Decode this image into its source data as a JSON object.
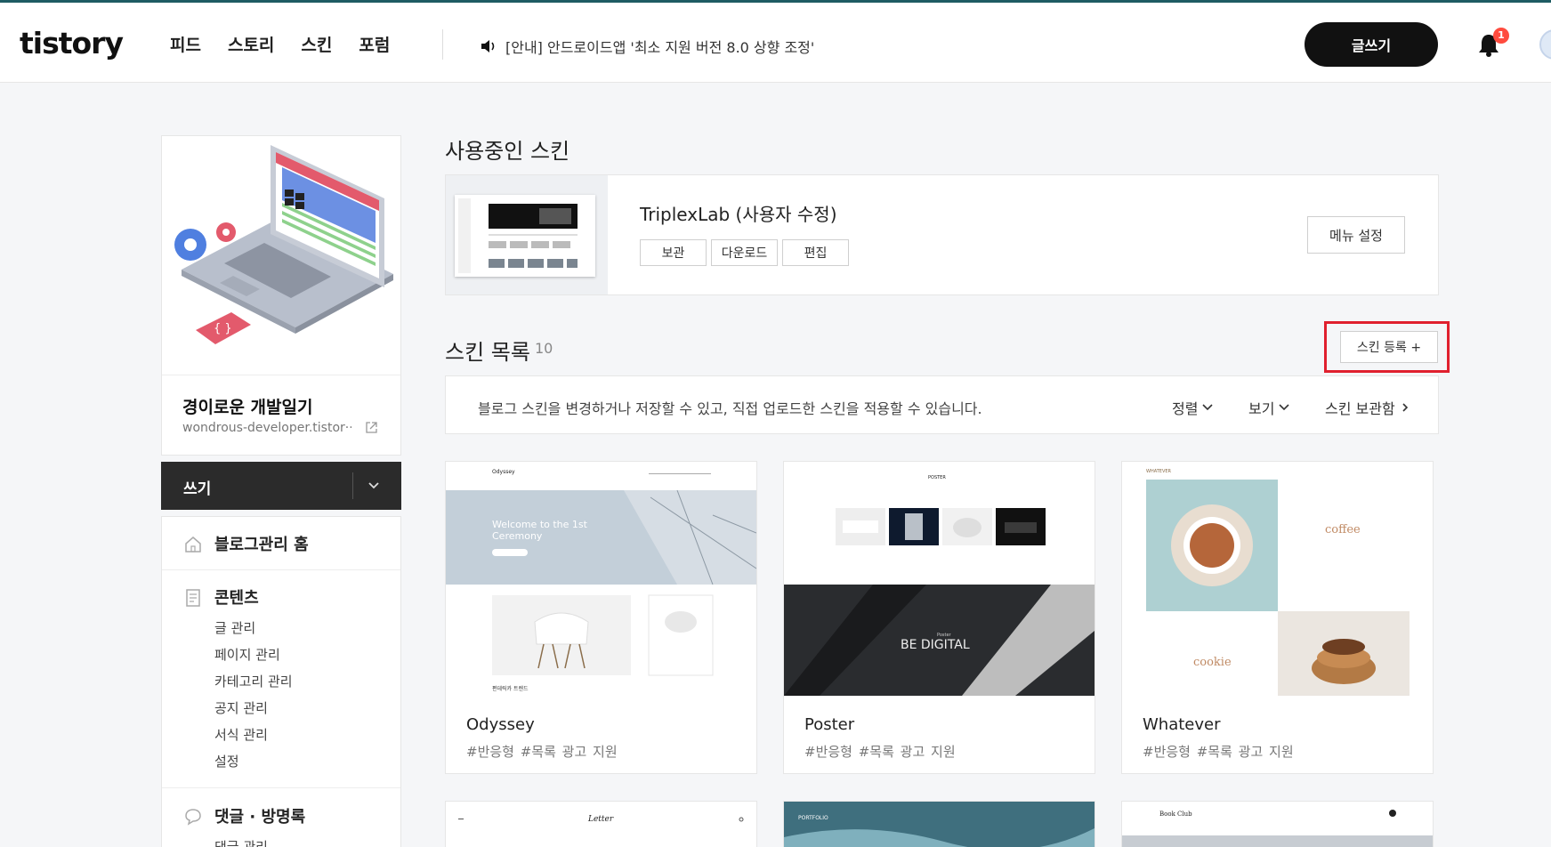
{
  "header": {
    "logo": "tistory",
    "nav": [
      "피드",
      "스토리",
      "스킨",
      "포럼"
    ],
    "notice": "[안내] 안드로이드앱 '최소 지원 버전 8.0 상향 조정'",
    "write_label": "글쓰기",
    "notification_count": "1"
  },
  "sidebar": {
    "blog_name": "경이로운 개발일기",
    "blog_url": "wondrous-developer.tistor···",
    "write_label": "쓰기",
    "home_label": "블로그관리 홈",
    "content_section": {
      "label": "콘텐츠",
      "items": [
        "글 관리",
        "페이지 관리",
        "카테고리 관리",
        "공지 관리",
        "서식 관리",
        "설정"
      ]
    },
    "comment_section": {
      "label": "댓글 · 방명록",
      "items": [
        "댓글 관리"
      ]
    }
  },
  "current_skin": {
    "heading": "사용중인 스킨",
    "name": "TriplexLab (사용자 수정)",
    "buttons": [
      "보관",
      "다운로드",
      "편집"
    ],
    "menu_settings_label": "메뉴 설정"
  },
  "skin_list": {
    "heading": "스킨 목록",
    "count": "10",
    "register_label": "스킨 등록 +",
    "description": "블로그 스킨을 변경하거나 저장할 수 있고, 직접 업로드한 스킨을 적용할 수 있습니다.",
    "sort_label": "정렬",
    "view_label": "보기",
    "storage_label": "스킨 보관함",
    "cards": [
      {
        "name": "Odyssey",
        "tags": "#반응형   #목록 광고 지원",
        "preview": {
          "brand": "Odyssey",
          "hero_line1": "Welcome to the 1st",
          "hero_line2": "Ceremony",
          "caption": "편데릭카 트렌드"
        }
      },
      {
        "name": "Poster",
        "tags": "#반응형   #목록 광고 지원",
        "preview": {
          "brand": "POSTER",
          "hero_text": "BE DIGITAL",
          "hero_small": "Poster"
        }
      },
      {
        "name": "Whatever",
        "tags": "#반응형   #목록 광고 지원",
        "preview": {
          "brand": "WHATEVER",
          "label_1": "coffee",
          "label_2": "cookie"
        }
      }
    ],
    "partial_cards": [
      {
        "brand": "Letter"
      },
      {
        "brand": "PORTFOLIO"
      },
      {
        "brand": "Book Club"
      }
    ]
  },
  "colors": {
    "accent_border": "#e0202e",
    "topbar_line": "#1f5c63",
    "primary_button": "#111111",
    "badge": "#ff4b3e"
  }
}
